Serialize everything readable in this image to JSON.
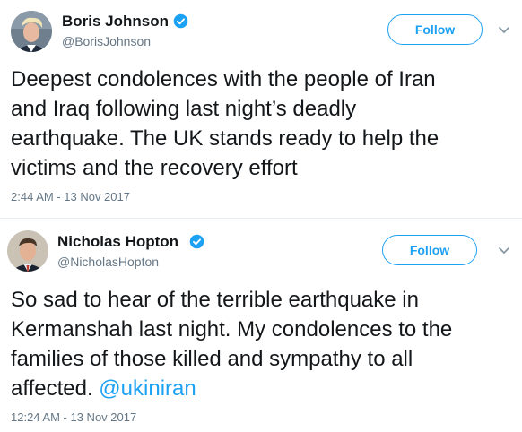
{
  "tweets": [
    {
      "name": "Boris Johnson",
      "handle": "@BorisJohnson",
      "follow_label": "Follow",
      "text_lines": [
        "Deepest condolences with the people of Iran",
        "and Iraq following last night’s deadly",
        "earthquake. The UK stands ready to help the",
        "victims and the recovery effort"
      ],
      "timestamp": "2:44 AM - 13 Nov 2017"
    },
    {
      "name": "Nicholas Hopton",
      "handle": "@NicholasHopton",
      "follow_label": "Follow",
      "text_lines": [
        "So sad to hear of the terrible earthquake in",
        "Kermanshah last night. My condolences to the",
        "families of those killed and sympathy to all",
        "affected. "
      ],
      "mention": "@ukiniran",
      "timestamp": "12:24 AM - 13 Nov 2017"
    }
  ],
  "colors": {
    "accent": "#1da1f2",
    "text": "#14171a",
    "secondary_text": "#657786",
    "divider": "#e6ecf0"
  },
  "icons": [
    "verified-badge-icon",
    "chevron-down-icon"
  ]
}
